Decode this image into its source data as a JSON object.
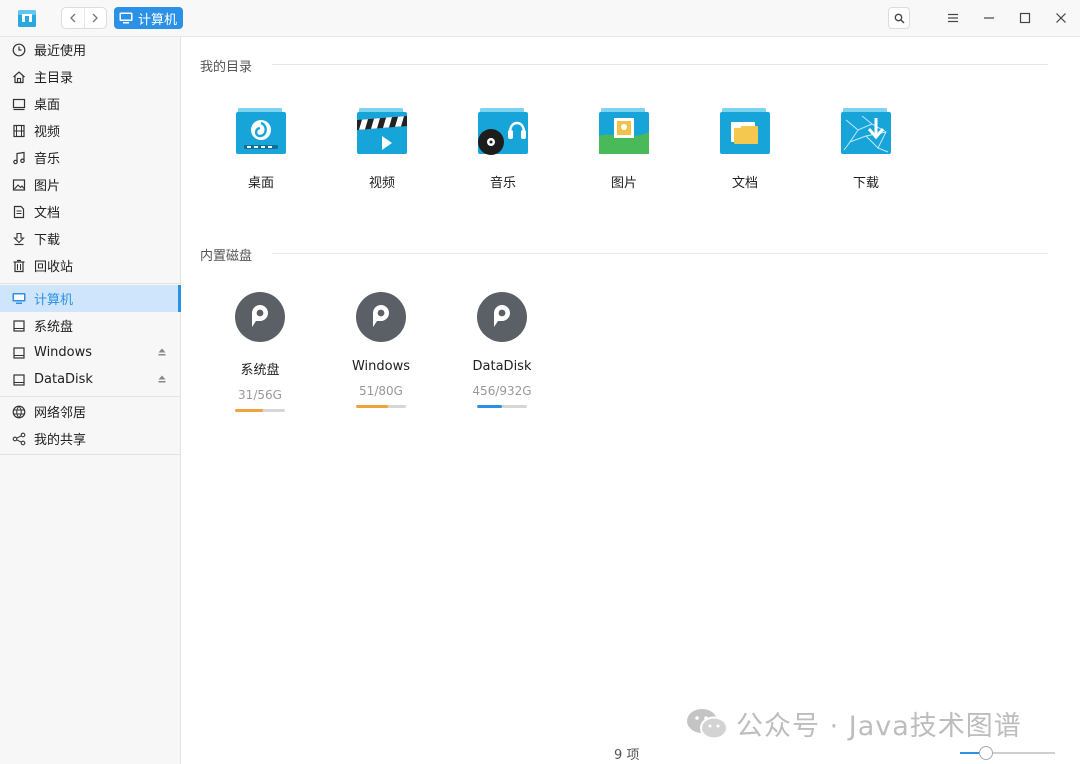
{
  "titlebar": {
    "back_icon": "chevron-left",
    "forward_icon": "chevron-right",
    "crumb_label": "计算机",
    "search_icon": "magnifier",
    "menu_icon": "hamburger",
    "minimize_icon": "minus",
    "maximize_icon": "square",
    "close_icon": "x"
  },
  "sidebar": {
    "items": [
      {
        "label": "最近使用",
        "icon": "clock-icon"
      },
      {
        "label": "主目录",
        "icon": "home-icon"
      },
      {
        "label": "桌面",
        "icon": "desktop-icon"
      },
      {
        "label": "视频",
        "icon": "film-icon"
      },
      {
        "label": "音乐",
        "icon": "music-icon"
      },
      {
        "label": "图片",
        "icon": "picture-icon"
      },
      {
        "label": "文档",
        "icon": "document-icon"
      },
      {
        "label": "下载",
        "icon": "download-icon"
      },
      {
        "label": "回收站",
        "icon": "trash-icon"
      },
      {
        "label": "计算机",
        "icon": "computer-icon",
        "active": true
      },
      {
        "label": "系统盘",
        "icon": "disk-icon"
      },
      {
        "label": "Windows",
        "icon": "disk-icon",
        "ejectable": true
      },
      {
        "label": "DataDisk",
        "icon": "disk-icon",
        "ejectable": true
      },
      {
        "label": "网络邻居",
        "icon": "network-icon"
      },
      {
        "label": "我的共享",
        "icon": "share-icon"
      }
    ]
  },
  "main": {
    "dirs_section": "我的目录",
    "dirs": [
      {
        "label": "桌面",
        "icon": "desktop-folder-icon"
      },
      {
        "label": "视频",
        "icon": "video-folder-icon"
      },
      {
        "label": "音乐",
        "icon": "music-folder-icon"
      },
      {
        "label": "图片",
        "icon": "picture-folder-icon"
      },
      {
        "label": "文档",
        "icon": "document-folder-icon"
      },
      {
        "label": "下载",
        "icon": "download-folder-icon"
      }
    ],
    "disks_section": "内置磁盘",
    "disks": [
      {
        "label": "系统盘",
        "usage": "31/56G",
        "fraction": 0.55,
        "color": "#f0a23b"
      },
      {
        "label": "Windows",
        "usage": "51/80G",
        "fraction": 0.64,
        "color": "#f0a23b"
      },
      {
        "label": "DataDisk",
        "usage": "456/932G",
        "fraction": 0.49,
        "color": "#2b91e6"
      }
    ]
  },
  "status": {
    "count": "9 项",
    "zoom_fraction": 0.27
  },
  "watermark": {
    "text": "公众号 · Java技术图谱"
  },
  "colors": {
    "accent": "#2b91e6",
    "folder": "#1aa0d8",
    "disk": "#5b6066"
  }
}
